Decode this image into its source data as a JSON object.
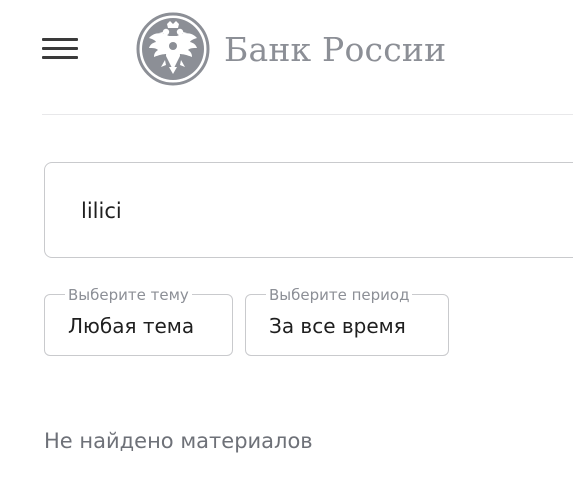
{
  "header": {
    "menu_icon": "hamburger-menu-icon",
    "logo_icon": "double-headed-eagle-emblem-icon",
    "logo_text": "Банк России",
    "brand_color": "#8c8f96"
  },
  "search": {
    "value": "lilici"
  },
  "filters": {
    "topic": {
      "label": "Выберите тему",
      "value": "Любая тема"
    },
    "period": {
      "label": "Выберите период",
      "value": "За все время"
    }
  },
  "results": {
    "empty_message": "Не найдено материалов"
  }
}
